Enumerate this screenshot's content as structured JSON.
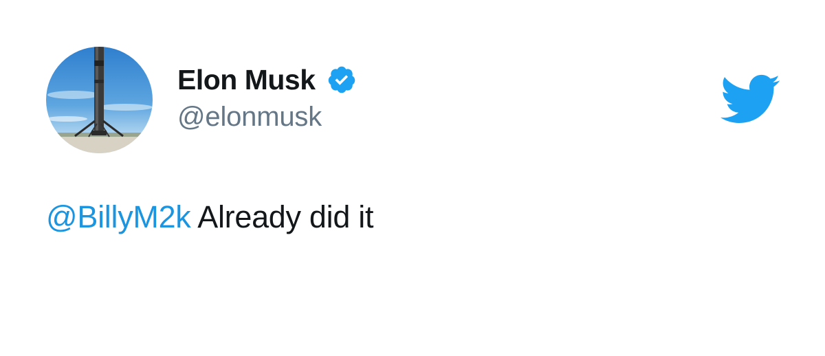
{
  "author": {
    "name": "Elon Musk",
    "handle": "@elonmusk",
    "verified": true,
    "avatar": "rocket-booster-photo"
  },
  "tweet": {
    "mention": "@BillyM2k",
    "text": "Already did it"
  },
  "icons": {
    "brand": "twitter-bird-icon",
    "verified": "verified-badge-icon"
  },
  "colors": {
    "twitter_blue": "#1da1f2",
    "mention_blue": "#1b95e0",
    "name_text": "#14171a",
    "handle_text": "#657786"
  }
}
